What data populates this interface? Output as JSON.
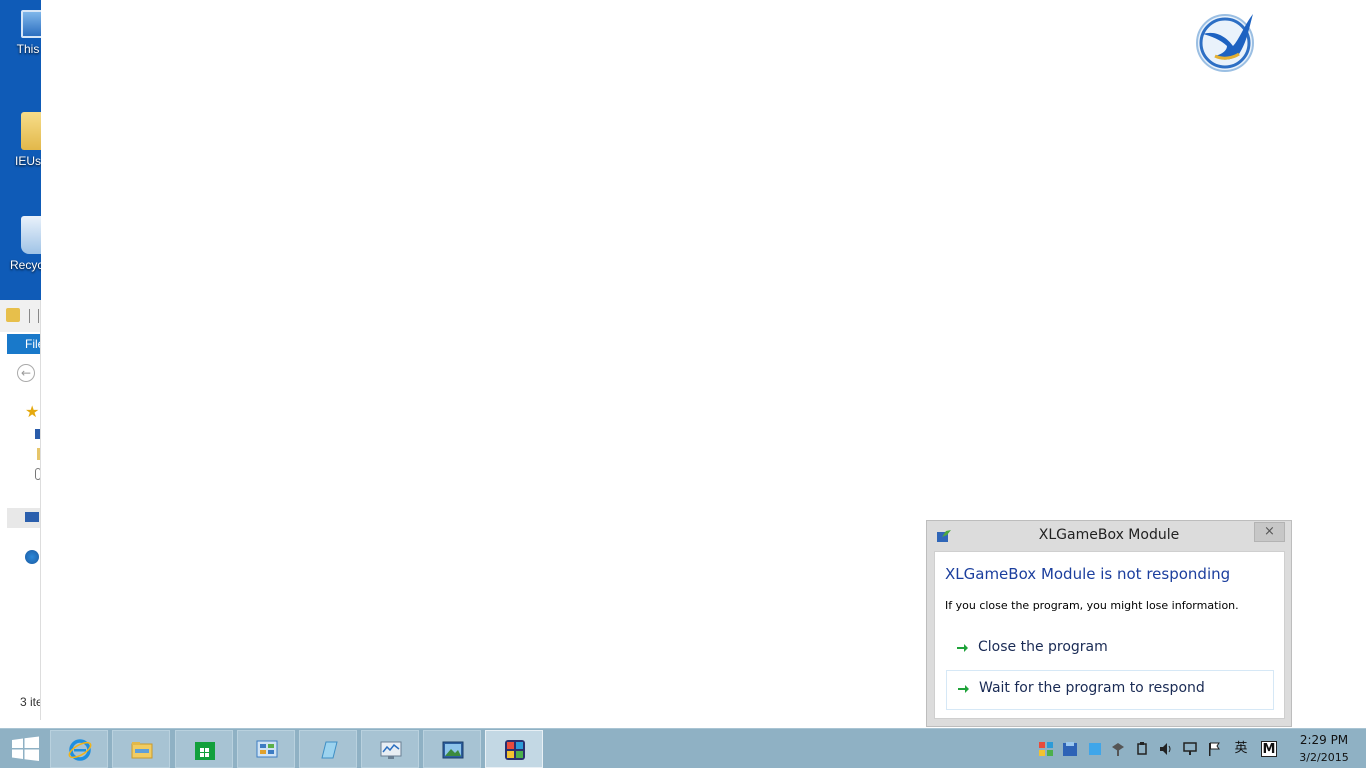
{
  "desktop": {
    "icons": [
      {
        "label": "This",
        "icon": "computer-icon"
      },
      {
        "label": "IEUs",
        "icon": "user-folder-icon"
      },
      {
        "label": "Recycl",
        "icon": "recycle-bin-icon"
      }
    ]
  },
  "explorer": {
    "file_tab": "File",
    "status": "3 ite"
  },
  "dialog": {
    "title": "XLGameBox Module",
    "close_glyph": "×",
    "heading": "XLGameBox Module is not responding",
    "info": "If you close the program, you might lose information.",
    "options": [
      {
        "label": "Close the program"
      },
      {
        "label": "Wait for the program to respond"
      }
    ],
    "colors": {
      "heading": "#1c3f9e",
      "arrow": "#1fa33a"
    }
  },
  "taskbar": {
    "apps": [
      {
        "name": "internet-explorer",
        "icon": "ie-icon"
      },
      {
        "name": "file-explorer",
        "icon": "folder-icon"
      },
      {
        "name": "store",
        "icon": "store-icon"
      },
      {
        "name": "control-panel",
        "icon": "control-panel-icon"
      },
      {
        "name": "notepad",
        "icon": "notepad-icon"
      },
      {
        "name": "performance",
        "icon": "monitor-icon"
      },
      {
        "name": "photos",
        "icon": "picture-icon"
      },
      {
        "name": "xlgamebox",
        "icon": "gamebox-icon",
        "active": true
      }
    ],
    "tray": {
      "ime_label": "英",
      "m_label": "M"
    },
    "clock": {
      "time": "2:29 PM",
      "date": "3/2/2015"
    }
  }
}
